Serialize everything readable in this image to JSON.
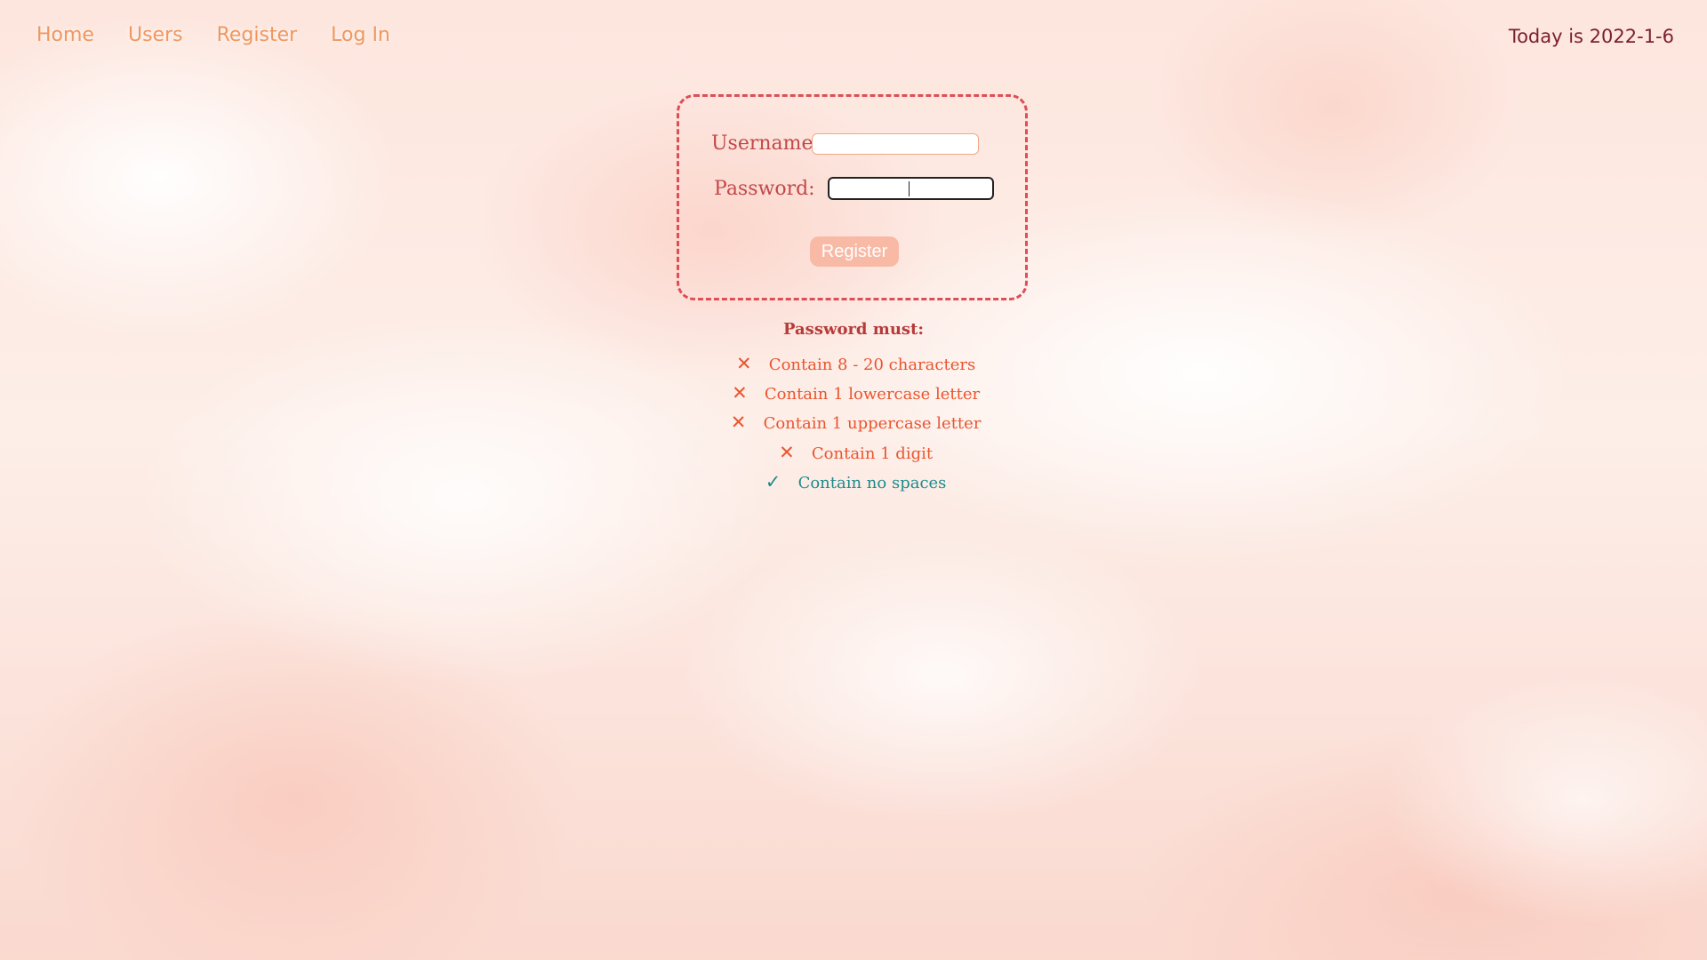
{
  "nav": {
    "items": [
      {
        "label": "Home"
      },
      {
        "label": "Users"
      },
      {
        "label": "Register"
      },
      {
        "label": "Log In"
      }
    ],
    "date_text": "Today is 2022-1-6"
  },
  "form": {
    "username_label": "Username:",
    "username_value": "",
    "password_label": "Password:",
    "password_value": "",
    "submit_label": "Register"
  },
  "rules": {
    "title": "Password must:",
    "items": [
      {
        "text": "Contain 8 - 20 characters",
        "met": false,
        "mark": "✕"
      },
      {
        "text": "Contain 1 lowercase letter",
        "met": false,
        "mark": "✕"
      },
      {
        "text": "Contain 1 uppercase letter",
        "met": false,
        "mark": "✕"
      },
      {
        "text": "Contain 1 digit",
        "met": false,
        "mark": "✕"
      },
      {
        "text": "Contain no spaces",
        "met": true,
        "mark": "✓"
      }
    ]
  },
  "colors": {
    "nav_link": "#f0975f",
    "date_text": "#7a1f2e",
    "box_border": "#de4e57",
    "fail": "#e9552f",
    "pass": "#1f8a8a",
    "button_bg": "#f8b9a5"
  }
}
